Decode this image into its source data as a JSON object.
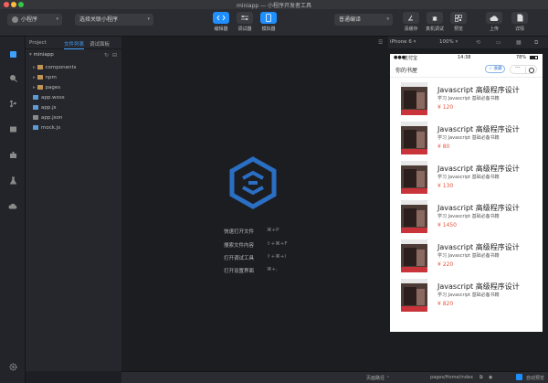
{
  "window": {
    "title": "miniapp — 小程序开发者工具"
  },
  "toolbar": {
    "mode_select": "小程序",
    "project_select": "选择关联小程序",
    "editor_label": "编辑器",
    "debugger_label": "调试器",
    "simulator_label": "模拟器",
    "compile_select": "普通编译",
    "clear_cache_label": "清缓存",
    "remote_debug_label": "真机调试",
    "preview_label": "预览",
    "upload_label": "上传",
    "details_label": "详情"
  },
  "explorer": {
    "title": "Project",
    "tabs": [
      "文件列表",
      "调试面板"
    ],
    "root": "miniapp",
    "items": [
      {
        "name": "components",
        "type": "folder"
      },
      {
        "name": "npm",
        "type": "folder"
      },
      {
        "name": "pages",
        "type": "folder"
      },
      {
        "name": "app.wxss",
        "type": "wxss"
      },
      {
        "name": "app.js",
        "type": "js"
      },
      {
        "name": "app.json",
        "type": "json"
      },
      {
        "name": "mock.js",
        "type": "js"
      }
    ]
  },
  "editor": {
    "shortcuts": [
      {
        "label": "快速打开文件",
        "keys": "⌘+P"
      },
      {
        "label": "搜索文件内容",
        "keys": "⇧+⌘+F"
      },
      {
        "label": "打开调试工具",
        "keys": "⇧+⌘+I"
      },
      {
        "label": "打开设置界面",
        "keys": "⌘+,"
      }
    ]
  },
  "simulator": {
    "device": "iPhone 6",
    "zoom": "100%",
    "status": {
      "carrier": "支付宝",
      "time": "14:38",
      "battery": "78%"
    },
    "page_title": "你的书屋",
    "fav_label": "收藏",
    "books": [
      {
        "title": "Javascript 高级程序设计",
        "subtitle": "学习 Javascript 基础必备书籍",
        "price": "¥ 120"
      },
      {
        "title": "Javascript 高级程序设计",
        "subtitle": "学习 Javascript 基础必备书籍",
        "price": "¥ 80"
      },
      {
        "title": "Javascript 高级程序设计",
        "subtitle": "学习 Javascript 基础必备书籍",
        "price": "¥ 130"
      },
      {
        "title": "Javascript 高级程序设计",
        "subtitle": "学习 Javascript 基础必备书籍",
        "price": "¥ 1450"
      },
      {
        "title": "Javascript 高级程序设计",
        "subtitle": "学习 Javascript 基础必备书籍",
        "price": "¥ 220"
      },
      {
        "title": "Javascript 高级程序设计",
        "subtitle": "学习 Javascript 基础必备书籍",
        "price": "¥ 820"
      }
    ]
  },
  "statusbar": {
    "page_path_label": "页面路径",
    "page_path": "pages/Home/index",
    "auto_preview_label": "自动预览"
  },
  "colors": {
    "accent": "#1f8fff",
    "price": "#e2573f"
  }
}
